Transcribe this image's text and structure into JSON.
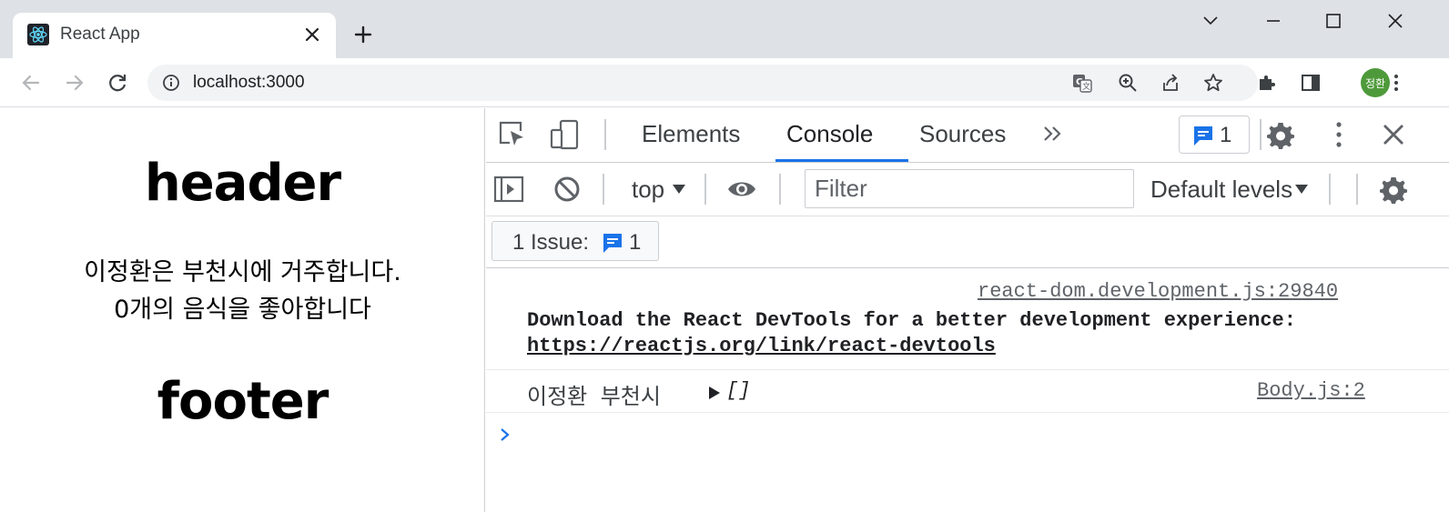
{
  "browser": {
    "tab_title": "React App",
    "url": "localhost:3000",
    "profile_initials": "정환"
  },
  "page": {
    "header": "header",
    "body_line1": "이정환은 부천시에 거주합니다.",
    "body_line2": "0개의 음식을 좋아합니다",
    "footer": "footer"
  },
  "devtools": {
    "tabs": [
      "Elements",
      "Console",
      "Sources"
    ],
    "active_tab": "Console",
    "issues_badge_count": "1",
    "context": "top",
    "filter_placeholder": "Filter",
    "levels": "Default levels",
    "issue_bar_label": "1 Issue:",
    "issue_bar_count": "1"
  },
  "console": {
    "msg1_source": "react-dom.development.js:29840",
    "msg1_text": "Download the React DevTools for a better development experience:",
    "msg1_link": "https://reactjs.org/link/react-devtools",
    "msg2_text": "이정환 부천시 ",
    "msg2_object": "[]",
    "msg2_source": "Body.js:2"
  },
  "colors": {
    "accent": "#1a73e8",
    "tabstrip": "#dee1e6",
    "avatar": "#4e9a3a"
  }
}
